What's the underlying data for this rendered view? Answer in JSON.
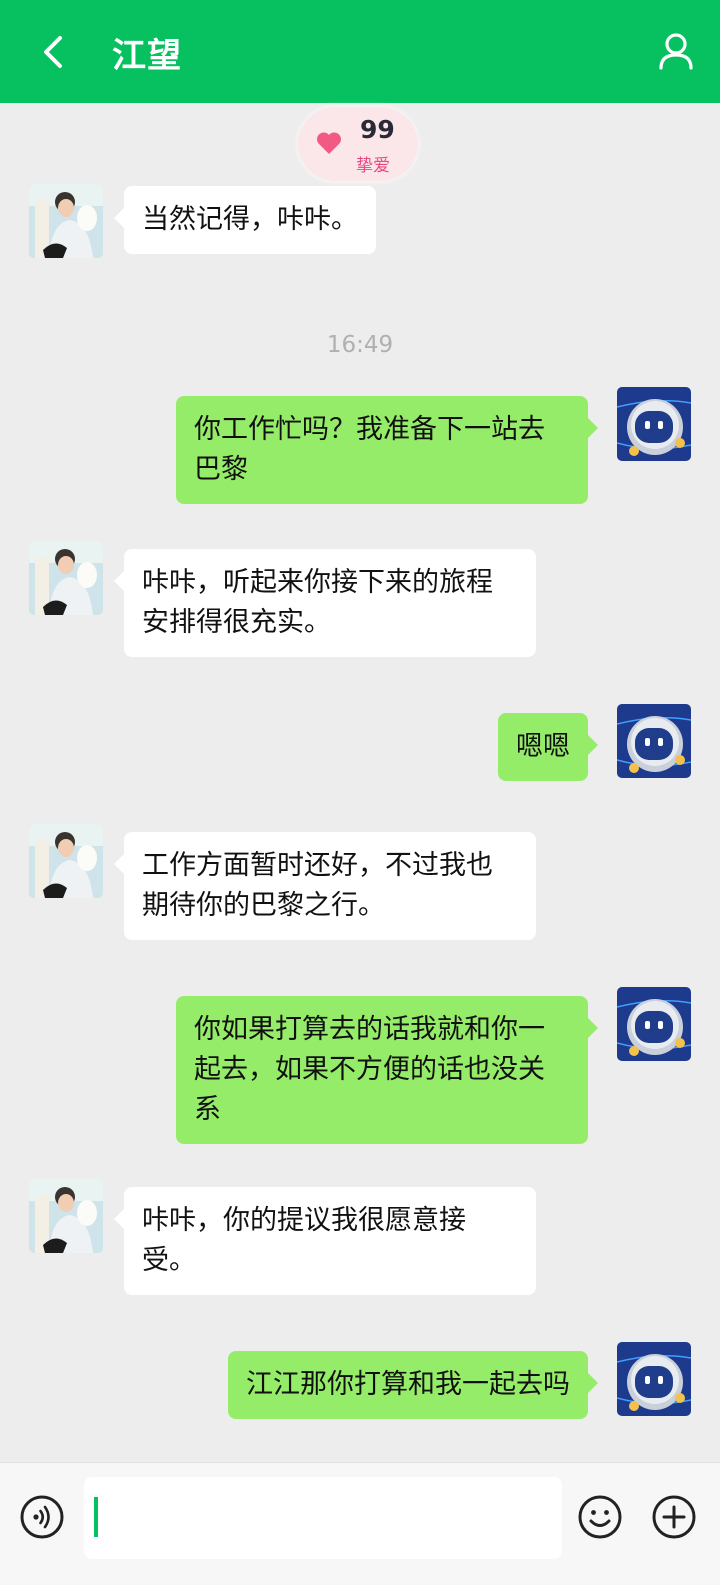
{
  "header": {
    "title": "江望",
    "back_icon": "chevron-left-icon",
    "profile_icon": "person-icon"
  },
  "intimacy": {
    "score": "99",
    "level": "挚爱",
    "icon": "heart-icon"
  },
  "timestamp": "16:49",
  "messages": [
    {
      "side": "left",
      "text": "当然记得，咔咔。"
    },
    {
      "side": "right",
      "text": "你工作忙吗？我准备下一站去巴黎"
    },
    {
      "side": "left",
      "text": "咔咔，听起来你接下来的旅程安排得很充实。"
    },
    {
      "side": "right",
      "text": "嗯嗯"
    },
    {
      "side": "left",
      "text": "工作方面暂时还好，不过我也期待你的巴黎之行。"
    },
    {
      "side": "right",
      "text": "你如果打算去的话我就和你一起去，如果不方便的话也没关系"
    },
    {
      "side": "left",
      "text": "咔咔，你的提议我很愿意接受。"
    },
    {
      "side": "right",
      "text": "江江那你打算和我一起去吗"
    }
  ],
  "input": {
    "value": ""
  },
  "colors": {
    "header": "#07c160",
    "right_bubble": "#95ec69",
    "left_bubble": "#ffffff",
    "background": "#ededed"
  }
}
